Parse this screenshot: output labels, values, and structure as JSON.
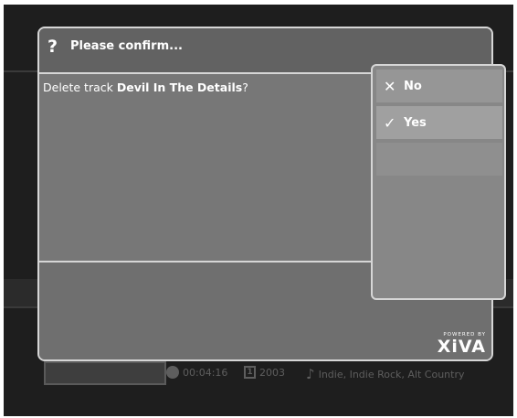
{
  "dialog": {
    "title": "Please confirm...",
    "question_icon": "?",
    "message_prefix": "Delete track ",
    "track_name": "Devil In The Details",
    "message_suffix": "?"
  },
  "menu": {
    "items": [
      {
        "label": "No",
        "icon": "close-icon",
        "glyph": "✕"
      },
      {
        "label": "Yes",
        "icon": "checkmark-icon",
        "glyph": "✓"
      }
    ]
  },
  "logo": {
    "powered_by": "POWERED BY",
    "brand": "XiVA"
  },
  "background": {
    "duration": "00:04:16",
    "year": "2003",
    "year_icon_digit": "1",
    "genre": "Indie, Indie Rock, Alt Country",
    "music_glyph": "♪"
  }
}
